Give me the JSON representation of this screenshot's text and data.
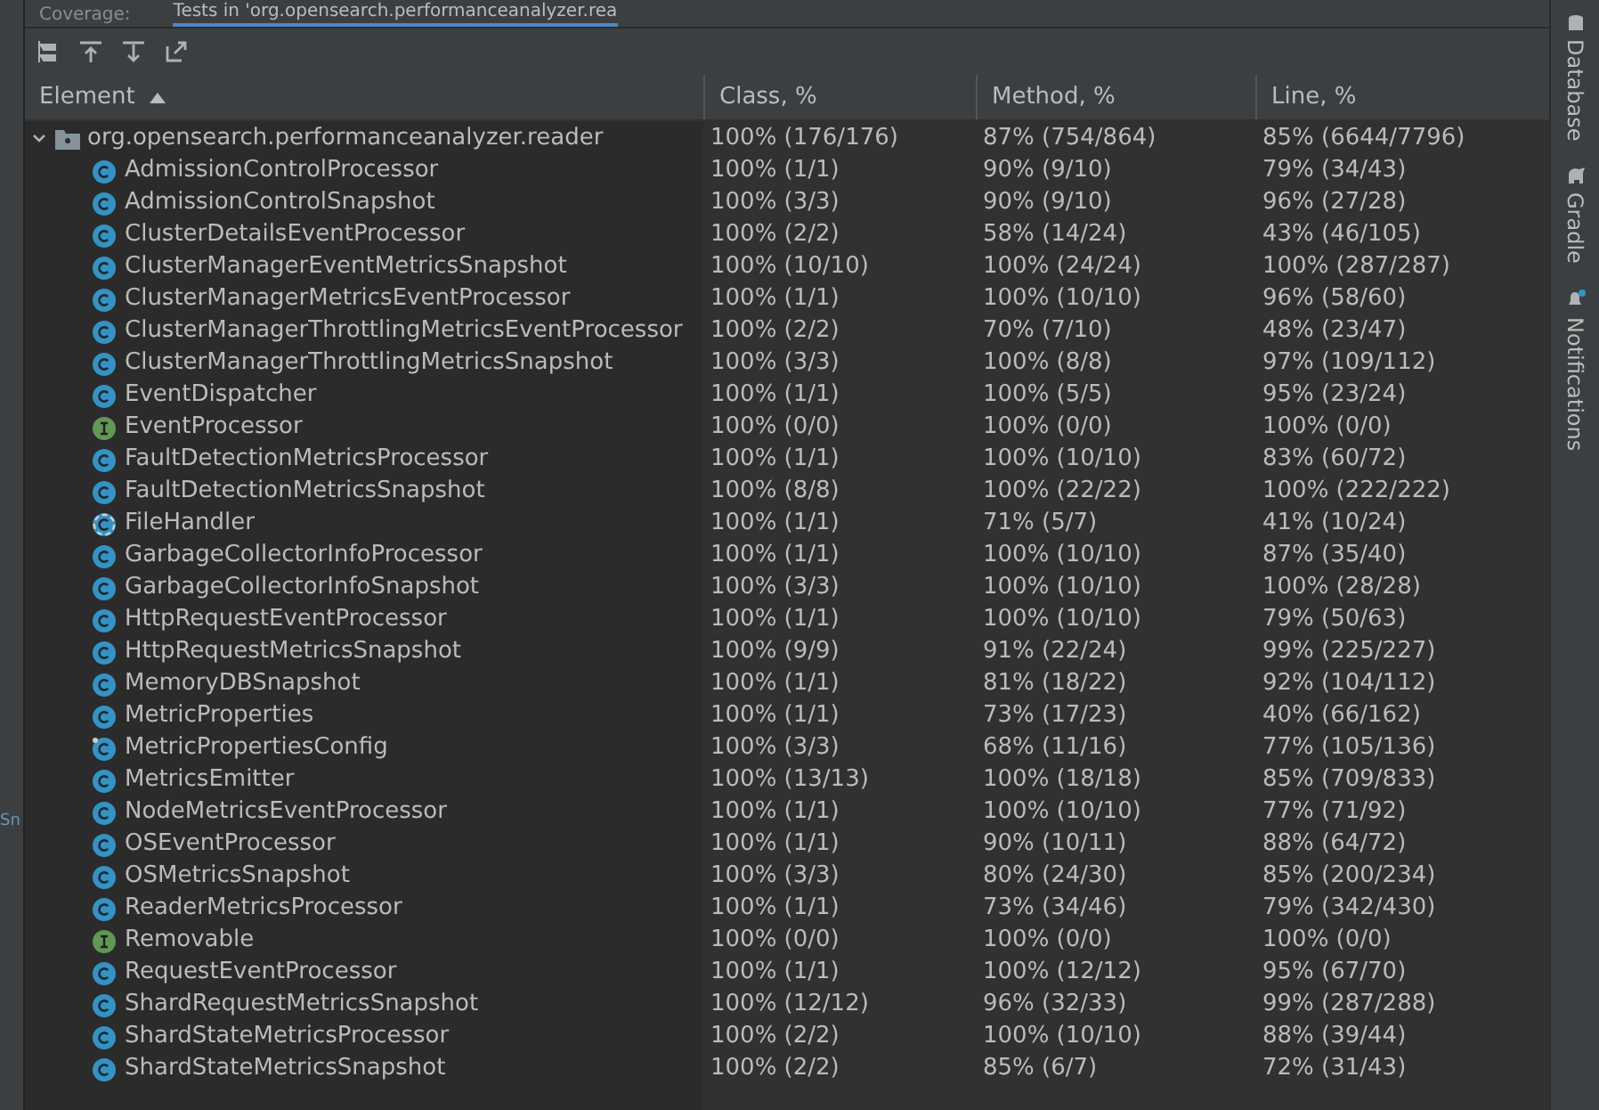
{
  "tabs": [
    {
      "label": "Coverage:",
      "selected": false
    },
    {
      "label": "Tests in 'org.opensearch.performanceanalyzer.rea",
      "selected": true
    }
  ],
  "left_panel_fragment": "Sn",
  "table": {
    "columns": [
      {
        "label": "Element",
        "sorted": true
      },
      {
        "label": "Class, %",
        "sorted": false
      },
      {
        "label": "Method, %",
        "sorted": false
      },
      {
        "label": "Line, %",
        "sorted": false
      }
    ],
    "package": {
      "name": "org.opensearch.performanceanalyzer.reader",
      "expanded": true,
      "class": "100% (176/176)",
      "method": "87% (754/864)",
      "line": "85% (6644/7796)"
    },
    "rows": [
      {
        "kind": "class",
        "name": "AdmissionControlProcessor",
        "class": "100% (1/1)",
        "method": "90% (9/10)",
        "line": "79% (34/43)"
      },
      {
        "kind": "class",
        "name": "AdmissionControlSnapshot",
        "class": "100% (3/3)",
        "method": "90% (9/10)",
        "line": "96% (27/28)"
      },
      {
        "kind": "class",
        "name": "ClusterDetailsEventProcessor",
        "class": "100% (2/2)",
        "method": "58% (14/24)",
        "line": "43% (46/105)"
      },
      {
        "kind": "class",
        "name": "ClusterManagerEventMetricsSnapshot",
        "class": "100% (10/10)",
        "method": "100% (24/24)",
        "line": "100% (287/287)"
      },
      {
        "kind": "class",
        "name": "ClusterManagerMetricsEventProcessor",
        "class": "100% (1/1)",
        "method": "100% (10/10)",
        "line": "96% (58/60)"
      },
      {
        "kind": "class",
        "name": "ClusterManagerThrottlingMetricsEventProcessor",
        "class": "100% (2/2)",
        "method": "70% (7/10)",
        "line": "48% (23/47)"
      },
      {
        "kind": "class",
        "name": "ClusterManagerThrottlingMetricsSnapshot",
        "class": "100% (3/3)",
        "method": "100% (8/8)",
        "line": "97% (109/112)"
      },
      {
        "kind": "class",
        "name": "EventDispatcher",
        "class": "100% (1/1)",
        "method": "100% (5/5)",
        "line": "95% (23/24)"
      },
      {
        "kind": "interface",
        "name": "EventProcessor",
        "class": "100% (0/0)",
        "method": "100% (0/0)",
        "line": "100% (0/0)"
      },
      {
        "kind": "class",
        "name": "FaultDetectionMetricsProcessor",
        "class": "100% (1/1)",
        "method": "100% (10/10)",
        "line": "83% (60/72)"
      },
      {
        "kind": "class",
        "name": "FaultDetectionMetricsSnapshot",
        "class": "100% (8/8)",
        "method": "100% (22/22)",
        "line": "100% (222/222)"
      },
      {
        "kind": "final",
        "name": "FileHandler",
        "class": "100% (1/1)",
        "method": "71% (5/7)",
        "line": "41% (10/24)"
      },
      {
        "kind": "class",
        "name": "GarbageCollectorInfoProcessor",
        "class": "100% (1/1)",
        "method": "100% (10/10)",
        "line": "87% (35/40)"
      },
      {
        "kind": "class",
        "name": "GarbageCollectorInfoSnapshot",
        "class": "100% (3/3)",
        "method": "100% (10/10)",
        "line": "100% (28/28)"
      },
      {
        "kind": "class",
        "name": "HttpRequestEventProcessor",
        "class": "100% (1/1)",
        "method": "100% (10/10)",
        "line": "79% (50/63)"
      },
      {
        "kind": "class",
        "name": "HttpRequestMetricsSnapshot",
        "class": "100% (9/9)",
        "method": "91% (22/24)",
        "line": "99% (225/227)"
      },
      {
        "kind": "class",
        "name": "MemoryDBSnapshot",
        "class": "100% (1/1)",
        "method": "81% (18/22)",
        "line": "92% (104/112)"
      },
      {
        "kind": "class",
        "name": "MetricProperties",
        "class": "100% (1/1)",
        "method": "73% (17/23)",
        "line": "40% (66/162)"
      },
      {
        "kind": "marked",
        "name": "MetricPropertiesConfig",
        "class": "100% (3/3)",
        "method": "68% (11/16)",
        "line": "77% (105/136)"
      },
      {
        "kind": "class",
        "name": "MetricsEmitter",
        "class": "100% (13/13)",
        "method": "100% (18/18)",
        "line": "85% (709/833)"
      },
      {
        "kind": "class",
        "name": "NodeMetricsEventProcessor",
        "class": "100% (1/1)",
        "method": "100% (10/10)",
        "line": "77% (71/92)"
      },
      {
        "kind": "class",
        "name": "OSEventProcessor",
        "class": "100% (1/1)",
        "method": "90% (10/11)",
        "line": "88% (64/72)"
      },
      {
        "kind": "class",
        "name": "OSMetricsSnapshot",
        "class": "100% (3/3)",
        "method": "80% (24/30)",
        "line": "85% (200/234)"
      },
      {
        "kind": "class",
        "name": "ReaderMetricsProcessor",
        "class": "100% (1/1)",
        "method": "73% (34/46)",
        "line": "79% (342/430)"
      },
      {
        "kind": "interface",
        "name": "Removable",
        "class": "100% (0/0)",
        "method": "100% (0/0)",
        "line": "100% (0/0)"
      },
      {
        "kind": "class",
        "name": "RequestEventProcessor",
        "class": "100% (1/1)",
        "method": "100% (12/12)",
        "line": "95% (67/70)"
      },
      {
        "kind": "class",
        "name": "ShardRequestMetricsSnapshot",
        "class": "100% (12/12)",
        "method": "96% (32/33)",
        "line": "99% (287/288)"
      },
      {
        "kind": "class",
        "name": "ShardStateMetricsProcessor",
        "class": "100% (2/2)",
        "method": "100% (10/10)",
        "line": "88% (39/44)"
      },
      {
        "kind": "class",
        "name": "ShardStateMetricsSnapshot",
        "class": "100% (2/2)",
        "method": "85% (6/7)",
        "line": "72% (31/43)"
      }
    ]
  },
  "side_tools": [
    {
      "kind": "database",
      "label": "Database"
    },
    {
      "kind": "gradle",
      "label": "Gradle"
    },
    {
      "kind": "bell",
      "label": "Notifications"
    }
  ]
}
